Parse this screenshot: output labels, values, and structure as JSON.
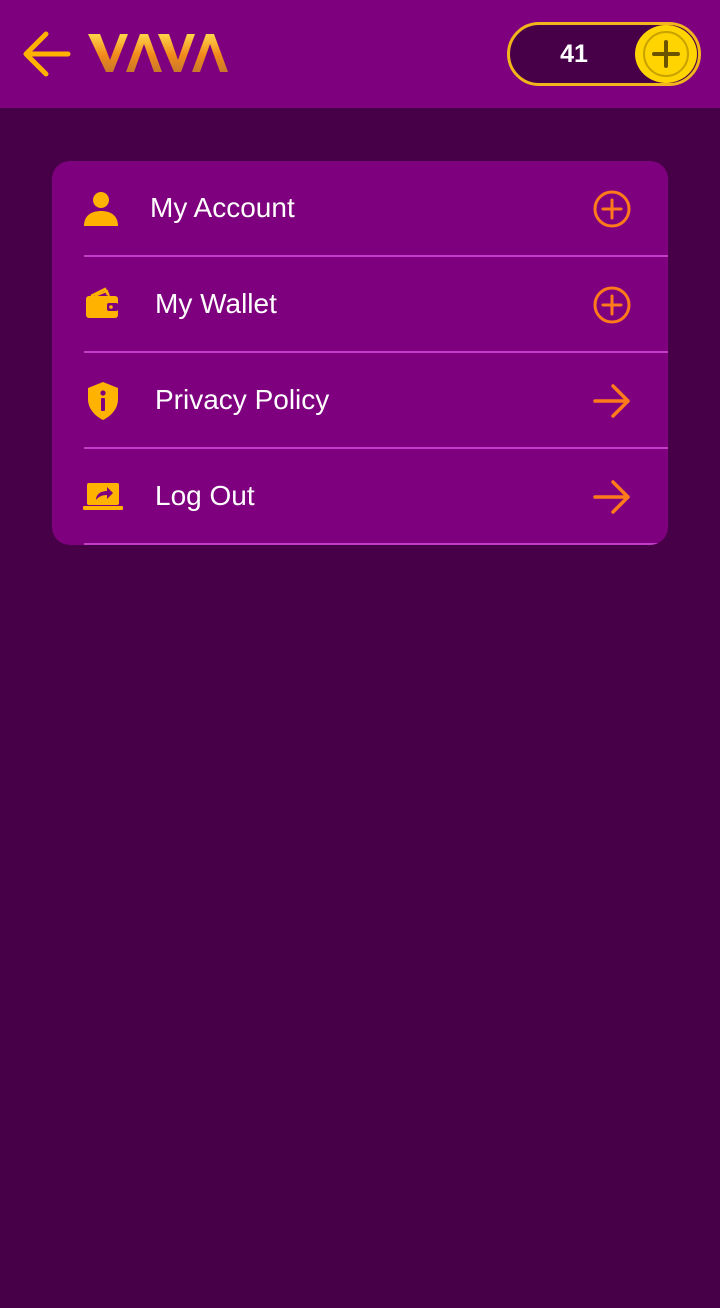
{
  "header": {
    "logo_text": "VAVA",
    "coin_balance": "41"
  },
  "menu": {
    "items": [
      {
        "label": "My Account",
        "icon": "person-icon",
        "action_icon": "plus-circle-icon"
      },
      {
        "label": "My Wallet",
        "icon": "wallet-icon",
        "action_icon": "plus-circle-icon"
      },
      {
        "label": "Privacy Policy",
        "icon": "shield-info-icon",
        "action_icon": "arrow-right-icon"
      },
      {
        "label": "Log Out",
        "icon": "laptop-share-icon",
        "action_icon": "arrow-right-icon"
      }
    ]
  },
  "colors": {
    "header_bg": "#7e007e",
    "page_bg": "#470048",
    "card_bg": "#7e007e",
    "accent_orange": "#ff7a1a",
    "accent_gold": "#ffb300",
    "coin_yellow": "#ffd400",
    "divider": "#c23cc6"
  }
}
